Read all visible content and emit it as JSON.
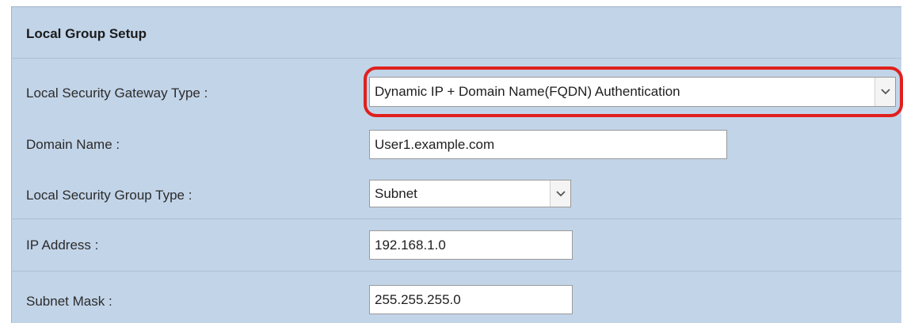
{
  "section": {
    "title": "Local Group Setup"
  },
  "gateway_type": {
    "label": "Local Security Gateway Type :",
    "value": "Dynamic IP + Domain Name(FQDN) Authentication",
    "icon": "chevron-down-icon"
  },
  "domain_name": {
    "label": "Domain Name :",
    "value": "User1.example.com"
  },
  "group_type": {
    "label": "Local Security Group Type :",
    "value": "Subnet",
    "icon": "chevron-down-icon"
  },
  "ip_address": {
    "label": "IP Address :",
    "value": "192.168.1.0"
  },
  "subnet_mask": {
    "label": "Subnet Mask :",
    "value": "255.255.255.0"
  },
  "colors": {
    "panel_bg": "#c2d4e8",
    "highlight_border": "#e0201c"
  }
}
